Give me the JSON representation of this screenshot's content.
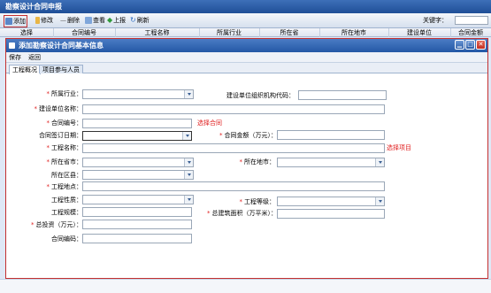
{
  "app": {
    "title": "勘察设计合同申报"
  },
  "outer_toolbar": {
    "add": "添加",
    "edit": "修改",
    "delete": "删除",
    "view": "查看",
    "report": "上报",
    "refresh": "刷新",
    "keyword_label": "关键字："
  },
  "outer_columns": [
    "选择",
    "合同编号",
    "工程名称",
    "所属行业",
    "所在省",
    "所在地市",
    "建设单位",
    "合同金额"
  ],
  "dialog": {
    "title": "添加勘察设计合同基本信息",
    "toolbar": {
      "save": "保存",
      "back": "返回"
    },
    "tabs": [
      "工程概况",
      "项目参与人员"
    ]
  },
  "form": {
    "industry": "所属行业：",
    "org_code": "建设单位组织机构代码：",
    "builder": "建设单位名称：",
    "contract_no": "合同编号：",
    "choose_contract": "选择合同",
    "sign_date": "合同签订日期：",
    "amount": "合同金额（万元）：",
    "project_name": "工程名称：",
    "choose_project": "选择项目",
    "province": "所在省市：",
    "city": "所在地市：",
    "district": "所在区县：",
    "location": "工程地点：",
    "nature": "工程性质：",
    "grade": "工程等级：",
    "scale": "工程规模：",
    "area": "总建筑面积（万平米）：",
    "investment": "总投资（万元）：",
    "contract_code": "合同编码："
  },
  "colors": {
    "required": "#e02020",
    "title_bar": "#2458a6",
    "dialog_border": "#c43030"
  }
}
